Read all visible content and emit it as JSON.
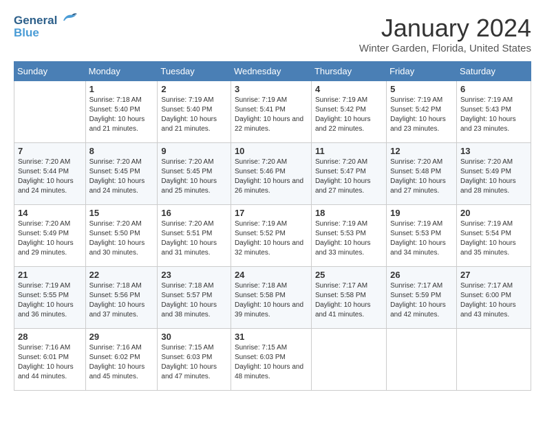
{
  "header": {
    "logo_line1": "General",
    "logo_line2": "Blue",
    "month": "January 2024",
    "location": "Winter Garden, Florida, United States"
  },
  "days_of_week": [
    "Sunday",
    "Monday",
    "Tuesday",
    "Wednesday",
    "Thursday",
    "Friday",
    "Saturday"
  ],
  "weeks": [
    [
      {
        "day": "",
        "sunrise": "",
        "sunset": "",
        "daylight": ""
      },
      {
        "day": "1",
        "sunrise": "Sunrise: 7:18 AM",
        "sunset": "Sunset: 5:40 PM",
        "daylight": "Daylight: 10 hours and 21 minutes."
      },
      {
        "day": "2",
        "sunrise": "Sunrise: 7:19 AM",
        "sunset": "Sunset: 5:40 PM",
        "daylight": "Daylight: 10 hours and 21 minutes."
      },
      {
        "day": "3",
        "sunrise": "Sunrise: 7:19 AM",
        "sunset": "Sunset: 5:41 PM",
        "daylight": "Daylight: 10 hours and 22 minutes."
      },
      {
        "day": "4",
        "sunrise": "Sunrise: 7:19 AM",
        "sunset": "Sunset: 5:42 PM",
        "daylight": "Daylight: 10 hours and 22 minutes."
      },
      {
        "day": "5",
        "sunrise": "Sunrise: 7:19 AM",
        "sunset": "Sunset: 5:42 PM",
        "daylight": "Daylight: 10 hours and 23 minutes."
      },
      {
        "day": "6",
        "sunrise": "Sunrise: 7:19 AM",
        "sunset": "Sunset: 5:43 PM",
        "daylight": "Daylight: 10 hours and 23 minutes."
      }
    ],
    [
      {
        "day": "7",
        "sunrise": "Sunrise: 7:20 AM",
        "sunset": "Sunset: 5:44 PM",
        "daylight": "Daylight: 10 hours and 24 minutes."
      },
      {
        "day": "8",
        "sunrise": "Sunrise: 7:20 AM",
        "sunset": "Sunset: 5:45 PM",
        "daylight": "Daylight: 10 hours and 24 minutes."
      },
      {
        "day": "9",
        "sunrise": "Sunrise: 7:20 AM",
        "sunset": "Sunset: 5:45 PM",
        "daylight": "Daylight: 10 hours and 25 minutes."
      },
      {
        "day": "10",
        "sunrise": "Sunrise: 7:20 AM",
        "sunset": "Sunset: 5:46 PM",
        "daylight": "Daylight: 10 hours and 26 minutes."
      },
      {
        "day": "11",
        "sunrise": "Sunrise: 7:20 AM",
        "sunset": "Sunset: 5:47 PM",
        "daylight": "Daylight: 10 hours and 27 minutes."
      },
      {
        "day": "12",
        "sunrise": "Sunrise: 7:20 AM",
        "sunset": "Sunset: 5:48 PM",
        "daylight": "Daylight: 10 hours and 27 minutes."
      },
      {
        "day": "13",
        "sunrise": "Sunrise: 7:20 AM",
        "sunset": "Sunset: 5:49 PM",
        "daylight": "Daylight: 10 hours and 28 minutes."
      }
    ],
    [
      {
        "day": "14",
        "sunrise": "Sunrise: 7:20 AM",
        "sunset": "Sunset: 5:49 PM",
        "daylight": "Daylight: 10 hours and 29 minutes."
      },
      {
        "day": "15",
        "sunrise": "Sunrise: 7:20 AM",
        "sunset": "Sunset: 5:50 PM",
        "daylight": "Daylight: 10 hours and 30 minutes."
      },
      {
        "day": "16",
        "sunrise": "Sunrise: 7:20 AM",
        "sunset": "Sunset: 5:51 PM",
        "daylight": "Daylight: 10 hours and 31 minutes."
      },
      {
        "day": "17",
        "sunrise": "Sunrise: 7:19 AM",
        "sunset": "Sunset: 5:52 PM",
        "daylight": "Daylight: 10 hours and 32 minutes."
      },
      {
        "day": "18",
        "sunrise": "Sunrise: 7:19 AM",
        "sunset": "Sunset: 5:53 PM",
        "daylight": "Daylight: 10 hours and 33 minutes."
      },
      {
        "day": "19",
        "sunrise": "Sunrise: 7:19 AM",
        "sunset": "Sunset: 5:53 PM",
        "daylight": "Daylight: 10 hours and 34 minutes."
      },
      {
        "day": "20",
        "sunrise": "Sunrise: 7:19 AM",
        "sunset": "Sunset: 5:54 PM",
        "daylight": "Daylight: 10 hours and 35 minutes."
      }
    ],
    [
      {
        "day": "21",
        "sunrise": "Sunrise: 7:19 AM",
        "sunset": "Sunset: 5:55 PM",
        "daylight": "Daylight: 10 hours and 36 minutes."
      },
      {
        "day": "22",
        "sunrise": "Sunrise: 7:18 AM",
        "sunset": "Sunset: 5:56 PM",
        "daylight": "Daylight: 10 hours and 37 minutes."
      },
      {
        "day": "23",
        "sunrise": "Sunrise: 7:18 AM",
        "sunset": "Sunset: 5:57 PM",
        "daylight": "Daylight: 10 hours and 38 minutes."
      },
      {
        "day": "24",
        "sunrise": "Sunrise: 7:18 AM",
        "sunset": "Sunset: 5:58 PM",
        "daylight": "Daylight: 10 hours and 39 minutes."
      },
      {
        "day": "25",
        "sunrise": "Sunrise: 7:17 AM",
        "sunset": "Sunset: 5:58 PM",
        "daylight": "Daylight: 10 hours and 41 minutes."
      },
      {
        "day": "26",
        "sunrise": "Sunrise: 7:17 AM",
        "sunset": "Sunset: 5:59 PM",
        "daylight": "Daylight: 10 hours and 42 minutes."
      },
      {
        "day": "27",
        "sunrise": "Sunrise: 7:17 AM",
        "sunset": "Sunset: 6:00 PM",
        "daylight": "Daylight: 10 hours and 43 minutes."
      }
    ],
    [
      {
        "day": "28",
        "sunrise": "Sunrise: 7:16 AM",
        "sunset": "Sunset: 6:01 PM",
        "daylight": "Daylight: 10 hours and 44 minutes."
      },
      {
        "day": "29",
        "sunrise": "Sunrise: 7:16 AM",
        "sunset": "Sunset: 6:02 PM",
        "daylight": "Daylight: 10 hours and 45 minutes."
      },
      {
        "day": "30",
        "sunrise": "Sunrise: 7:15 AM",
        "sunset": "Sunset: 6:03 PM",
        "daylight": "Daylight: 10 hours and 47 minutes."
      },
      {
        "day": "31",
        "sunrise": "Sunrise: 7:15 AM",
        "sunset": "Sunset: 6:03 PM",
        "daylight": "Daylight: 10 hours and 48 minutes."
      },
      {
        "day": "",
        "sunrise": "",
        "sunset": "",
        "daylight": ""
      },
      {
        "day": "",
        "sunrise": "",
        "sunset": "",
        "daylight": ""
      },
      {
        "day": "",
        "sunrise": "",
        "sunset": "",
        "daylight": ""
      }
    ]
  ]
}
